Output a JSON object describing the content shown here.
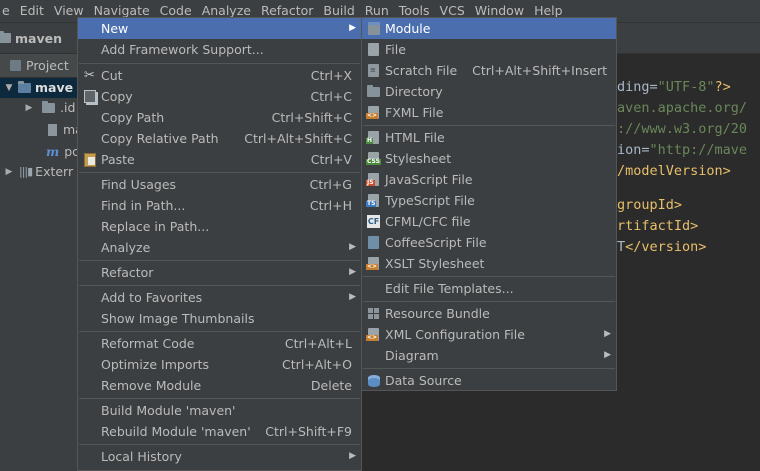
{
  "menubar": {
    "items": [
      "e",
      "Edit",
      "View",
      "Navigate",
      "Code",
      "Analyze",
      "Refactor",
      "Build",
      "Run",
      "Tools",
      "VCS",
      "Window",
      "Help"
    ]
  },
  "navbar": {
    "project": "maven"
  },
  "project_panel": {
    "tab_label": "Project",
    "tree": [
      "mave",
      ".id",
      "ma",
      "pc",
      "Exterr"
    ]
  },
  "editor": {
    "lines": [
      {
        "t": "ding=",
        "c": "plain"
      },
      {
        "t": "\"UTF-8\"",
        "c": "green"
      },
      {
        "t": "?>",
        "c": "tag"
      }
    ],
    "line1": [
      "ding=",
      "\"UTF-8\"",
      "?>"
    ],
    "line2": "aven.apache.org/",
    "line3": "://www.w3.org/20",
    "line4": [
      "ion=",
      "\"http://mave"
    ],
    "line5": "/modelVersion>",
    "line6": "groupId>",
    "line7": "rtifactId>",
    "line8": [
      "T",
      "</version>"
    ]
  },
  "context_menu": {
    "items": [
      {
        "label": "New",
        "shortcut": "",
        "submenu": true,
        "icon": ""
      },
      {
        "label": "Add Framework Support...",
        "shortcut": "",
        "submenu": false,
        "icon": ""
      },
      {
        "label": "Cut",
        "shortcut": "Ctrl+X",
        "submenu": false,
        "icon": "scissors-icon"
      },
      {
        "label": "Copy",
        "shortcut": "Ctrl+C",
        "submenu": false,
        "icon": "copy-icon"
      },
      {
        "label": "Copy Path",
        "shortcut": "Ctrl+Shift+C",
        "submenu": false,
        "icon": ""
      },
      {
        "label": "Copy Relative Path",
        "shortcut": "Ctrl+Alt+Shift+C",
        "submenu": false,
        "icon": ""
      },
      {
        "label": "Paste",
        "shortcut": "Ctrl+V",
        "submenu": false,
        "icon": "paste-icon"
      },
      {
        "label": "Find Usages",
        "shortcut": "Ctrl+G",
        "submenu": false,
        "icon": ""
      },
      {
        "label": "Find in Path...",
        "shortcut": "Ctrl+H",
        "submenu": false,
        "icon": ""
      },
      {
        "label": "Replace in Path...",
        "shortcut": "",
        "submenu": false,
        "icon": ""
      },
      {
        "label": "Analyze",
        "shortcut": "",
        "submenu": true,
        "icon": ""
      },
      {
        "label": "Refactor",
        "shortcut": "",
        "submenu": true,
        "icon": ""
      },
      {
        "label": "Add to Favorites",
        "shortcut": "",
        "submenu": true,
        "icon": ""
      },
      {
        "label": "Show Image Thumbnails",
        "shortcut": "",
        "submenu": false,
        "icon": ""
      },
      {
        "label": "Reformat Code",
        "shortcut": "Ctrl+Alt+L",
        "submenu": false,
        "icon": ""
      },
      {
        "label": "Optimize Imports",
        "shortcut": "Ctrl+Alt+O",
        "submenu": false,
        "icon": ""
      },
      {
        "label": "Remove Module",
        "shortcut": "Delete",
        "submenu": false,
        "icon": ""
      },
      {
        "label": "Build Module 'maven'",
        "shortcut": "",
        "submenu": false,
        "icon": ""
      },
      {
        "label": "Rebuild Module 'maven'",
        "shortcut": "Ctrl+Shift+F9",
        "submenu": false,
        "icon": ""
      },
      {
        "label": "Local History",
        "shortcut": "",
        "submenu": true,
        "icon": ""
      }
    ]
  },
  "new_submenu": {
    "items": [
      {
        "label": "Module",
        "shortcut": "",
        "submenu": false,
        "icon": "module-icon"
      },
      {
        "label": "File",
        "shortcut": "",
        "submenu": false,
        "icon": "file-icon"
      },
      {
        "label": "Scratch File",
        "shortcut": "Ctrl+Alt+Shift+Insert",
        "submenu": false,
        "icon": "scratch-file-icon"
      },
      {
        "label": "Directory",
        "shortcut": "",
        "submenu": false,
        "icon": "folder-icon"
      },
      {
        "label": "FXML File",
        "shortcut": "",
        "submenu": false,
        "icon": "fxml-file-icon"
      },
      {
        "label": "HTML File",
        "shortcut": "",
        "submenu": false,
        "icon": "html-file-icon"
      },
      {
        "label": "Stylesheet",
        "shortcut": "",
        "submenu": false,
        "icon": "css-file-icon"
      },
      {
        "label": "JavaScript File",
        "shortcut": "",
        "submenu": false,
        "icon": "js-file-icon"
      },
      {
        "label": "TypeScript File",
        "shortcut": "",
        "submenu": false,
        "icon": "ts-file-icon"
      },
      {
        "label": "CFML/CFC file",
        "shortcut": "",
        "submenu": false,
        "icon": "cfml-file-icon"
      },
      {
        "label": "CoffeeScript File",
        "shortcut": "",
        "submenu": false,
        "icon": "coffeescript-file-icon"
      },
      {
        "label": "XSLT Stylesheet",
        "shortcut": "",
        "submenu": false,
        "icon": "xslt-file-icon"
      },
      {
        "label": "Edit File Templates...",
        "shortcut": "",
        "submenu": false,
        "icon": ""
      },
      {
        "label": "Resource Bundle",
        "shortcut": "",
        "submenu": false,
        "icon": "resource-bundle-icon"
      },
      {
        "label": "XML Configuration File",
        "shortcut": "",
        "submenu": true,
        "icon": "xml-file-icon"
      },
      {
        "label": "Diagram",
        "shortcut": "",
        "submenu": true,
        "icon": ""
      },
      {
        "label": "Data Source",
        "shortcut": "",
        "submenu": false,
        "icon": "database-icon"
      }
    ]
  },
  "colors": {
    "highlight": "#4b6eaf",
    "menu_bg": "#3c3f41",
    "editor_bg": "#2b2b2b"
  }
}
